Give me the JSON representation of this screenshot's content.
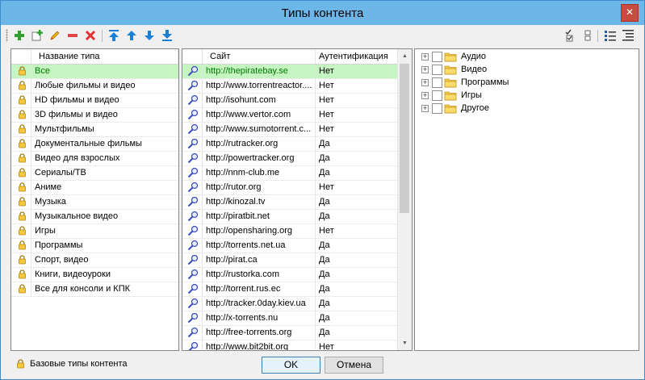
{
  "window": {
    "title": "Типы контента",
    "close_glyph": "✕"
  },
  "toolbar": {
    "left": [
      "add-icon",
      "add-child-icon",
      "edit-icon",
      "remove-icon",
      "delete-icon",
      "move-top-icon",
      "move-up-icon",
      "move-down-icon",
      "move-bottom-icon"
    ],
    "right": [
      "check-all-icon",
      "uncheck-all-icon",
      "list-view-icon",
      "tree-view-icon"
    ]
  },
  "types": {
    "header": "Название типа",
    "items": [
      "Все",
      "Любые фильмы и видео",
      "HD фильмы и видео",
      "3D фильмы и видео",
      "Мультфильмы",
      "Документальные фильмы",
      "Видео для взрослых",
      "Сериалы/ТВ",
      "Аниме",
      "Музыка",
      "Музыкальное видео",
      "Игры",
      "Программы",
      "Спорт, видео",
      "Книги, видеоуроки",
      "Все для консоли и КПК"
    ],
    "selected_index": 0
  },
  "sites": {
    "header_site": "Сайт",
    "header_auth": "Аутентификация",
    "rows": [
      {
        "url": "http://thepiratebay.se",
        "auth": "Нет"
      },
      {
        "url": "http://www.torrentreactor....",
        "auth": "Нет"
      },
      {
        "url": "http://isohunt.com",
        "auth": "Нет"
      },
      {
        "url": "http://www.vertor.com",
        "auth": "Нет"
      },
      {
        "url": "http://www.sumotorrent.c...",
        "auth": "Нет"
      },
      {
        "url": "http://rutracker.org",
        "auth": "Да"
      },
      {
        "url": "http://powertracker.org",
        "auth": "Да"
      },
      {
        "url": "http://nnm-club.me",
        "auth": "Да"
      },
      {
        "url": "http://rutor.org",
        "auth": "Нет"
      },
      {
        "url": "http://kinozal.tv",
        "auth": "Да"
      },
      {
        "url": "http://piratbit.net",
        "auth": "Да"
      },
      {
        "url": "http://opensharing.org",
        "auth": "Нет"
      },
      {
        "url": "http://torrents.net.ua",
        "auth": "Да"
      },
      {
        "url": "http://pirat.ca",
        "auth": "Да"
      },
      {
        "url": "http://rustorka.com",
        "auth": "Да"
      },
      {
        "url": "http://torrent.rus.ec",
        "auth": "Да"
      },
      {
        "url": "http://tracker.0day.kiev.ua",
        "auth": "Да"
      },
      {
        "url": "http://x-torrents.nu",
        "auth": "Да"
      },
      {
        "url": "http://free-torrents.org",
        "auth": "Да"
      },
      {
        "url": "http://www.bit2bit.org",
        "auth": "Нет"
      }
    ],
    "selected_index": 0,
    "scroll_visible_fraction": 0.55
  },
  "categories": {
    "items": [
      "Аудио",
      "Видео",
      "Программы",
      "Игры",
      "Другое"
    ],
    "expander_glyph": "+"
  },
  "footer": {
    "legend": "Базовые типы контента",
    "ok": "OK",
    "cancel": "Отмена"
  },
  "colors": {
    "selection": "#c5f5c1",
    "selected_text": "#007a00",
    "titlebar": "#6cb6e8",
    "close": "#c74b40"
  }
}
